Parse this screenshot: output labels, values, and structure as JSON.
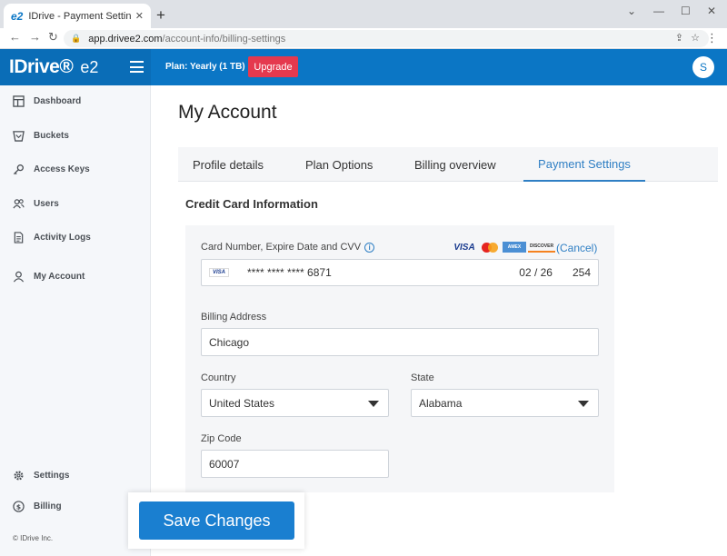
{
  "browser": {
    "tab_favicon": "e2",
    "tab_title": "IDrive - Payment Settings",
    "tab_close": "✕",
    "new_tab": "+",
    "url_host": "app.drivee2.com",
    "url_path": "/account-info/billing-settings"
  },
  "header": {
    "logo": "IDrive®",
    "logo_suffix": "e2",
    "plan": "Plan: Yearly (1 TB)",
    "upgrade_label": "Upgrade",
    "avatar_initial": "S"
  },
  "sidebar": {
    "items": [
      {
        "label": "Dashboard",
        "icon": "dashboard-icon"
      },
      {
        "label": "Buckets",
        "icon": "bucket-icon"
      },
      {
        "label": "Access Keys",
        "icon": "key-icon"
      },
      {
        "label": "Users",
        "icon": "users-icon"
      },
      {
        "label": "Activity Logs",
        "icon": "log-icon"
      },
      {
        "label": "My Account",
        "icon": "user-icon"
      }
    ],
    "bottom_items": [
      {
        "label": "Settings",
        "icon": "gear-icon"
      },
      {
        "label": "Billing",
        "icon": "dollar-icon"
      }
    ],
    "copyright": "© IDrive Inc."
  },
  "main": {
    "title": "My Account",
    "tabs": [
      {
        "label": "Profile details",
        "active": false
      },
      {
        "label": "Plan Options",
        "active": false
      },
      {
        "label": "Billing overview",
        "active": false
      },
      {
        "label": "Payment Settings",
        "active": true
      }
    ],
    "section_title": "Credit Card Information",
    "card": {
      "label": "Card Number, Expire Date and CVV",
      "logos": [
        "VISA",
        "MasterCard",
        "AMERICAN EXPRESS",
        "DISCOVER"
      ],
      "cancel": "(Cancel)",
      "brand": "VISA",
      "number": "**** **** **** 6871",
      "expiry": "02 / 26",
      "cvv": "254"
    },
    "billing_address": {
      "label": "Billing Address",
      "value": "Chicago"
    },
    "country": {
      "label": "Country",
      "value": "United States"
    },
    "state": {
      "label": "State",
      "value": "Alabama"
    },
    "zip": {
      "label": "Zip Code",
      "value": "60007"
    },
    "save_label": "Save Changes"
  },
  "colors": {
    "brand_blue": "#0b76c5",
    "upgrade_red": "#e5394e",
    "active_tab": "#2f7fc4",
    "save_button": "#1a7fd0"
  }
}
